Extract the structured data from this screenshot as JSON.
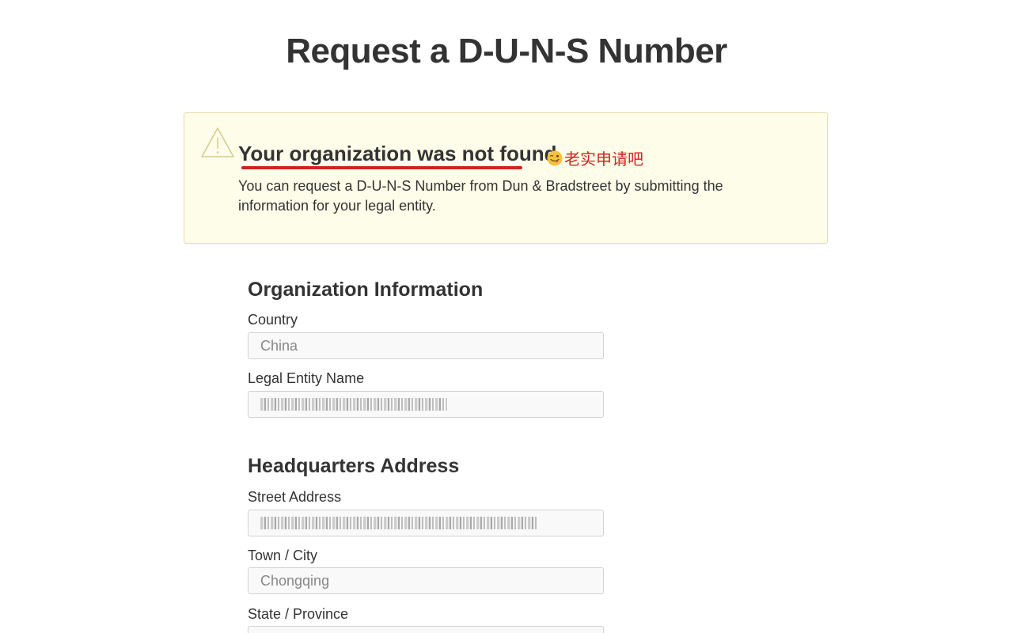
{
  "page": {
    "title": "Request a D-U-N-S Number"
  },
  "alert": {
    "icon": "warning-triangle-icon",
    "heading": "Your organization was not found.",
    "annotation_text": "老实申请吧",
    "annotation_emoji": "winking-tongue-face",
    "annotation_color": "#d0231f",
    "body": "You can request a D-U-N-S Number from Dun & Bradstreet by submitting the information for your legal entity.",
    "background": "#fefde9",
    "border": "#e8dcae"
  },
  "organization": {
    "section_title": "Organization Information",
    "country_label": "Country",
    "country_value": "China",
    "legal_entity_label": "Legal Entity Name",
    "legal_entity_value": "Chongqing ·········· Co., Ltd"
  },
  "headquarters": {
    "section_title": "Headquarters Address",
    "street_label": "Street Address",
    "street_value": "No. ···, ······ ········, ····· ·······, ······",
    "city_label": "Town / City",
    "city_value": "Chongqing",
    "state_label": "State / Province",
    "state_value": ""
  }
}
